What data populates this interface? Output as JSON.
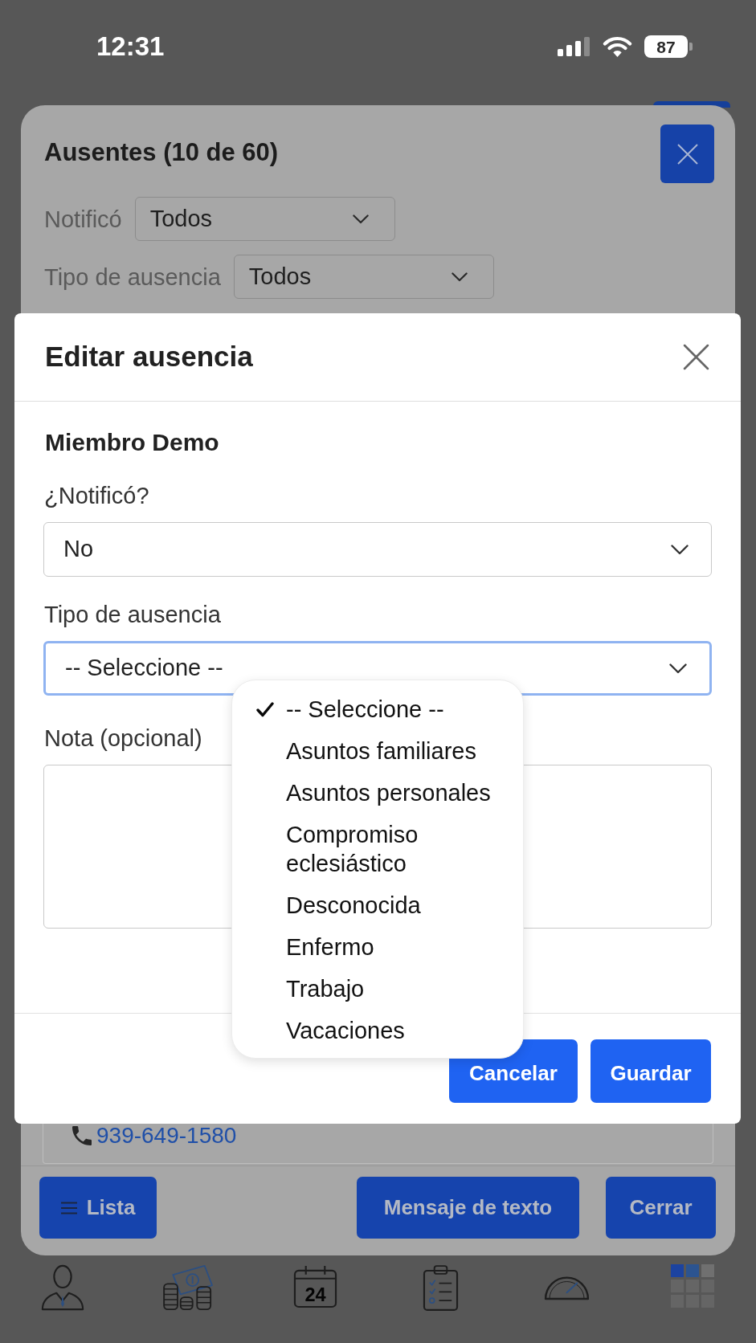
{
  "status_bar": {
    "time": "12:31",
    "battery": "87"
  },
  "background_dialog": {
    "title": "Ausentes (10 de 60)",
    "filters": [
      {
        "label": "Notificó",
        "value": "Todos"
      },
      {
        "label": "Tipo de ausencia",
        "value": "Todos"
      }
    ],
    "phone": "939-649-1580",
    "buttons": [
      {
        "label": "Lista",
        "kind": "icon_text"
      },
      {
        "label": "Mensaje de texto",
        "kind": "text"
      },
      {
        "label": "Cerrar",
        "kind": "text"
      }
    ]
  },
  "dialog": {
    "title": "Editar ausencia",
    "member": "Miembro Demo",
    "fields": [
      {
        "kind": "select",
        "label": "¿Notificó?",
        "value": "No",
        "focused": false
      },
      {
        "kind": "select",
        "label": "Tipo de ausencia",
        "value": "-- Seleccione --",
        "focused": true
      },
      {
        "kind": "textarea",
        "label": "Nota (opcional)"
      }
    ],
    "buttons": [
      "Cancelar",
      "Guardar"
    ]
  },
  "dropdown": {
    "options": [
      {
        "label": "-- Seleccione --",
        "selected": true
      },
      {
        "label": "Asuntos familiares",
        "selected": false
      },
      {
        "label": "Asuntos personales",
        "selected": false
      },
      {
        "label": "Compromiso eclesiástico",
        "selected": false
      },
      {
        "label": "Desconocida",
        "selected": false
      },
      {
        "label": "Enfermo",
        "selected": false
      },
      {
        "label": "Trabajo",
        "selected": false
      },
      {
        "label": "Vacaciones",
        "selected": false
      }
    ]
  },
  "tab_bar": {
    "items": [
      {
        "kind": "person"
      },
      {
        "kind": "money"
      },
      {
        "kind": "calendar",
        "text": "24"
      },
      {
        "kind": "clipboard"
      },
      {
        "kind": "gauge"
      },
      {
        "kind": "apps"
      }
    ]
  }
}
